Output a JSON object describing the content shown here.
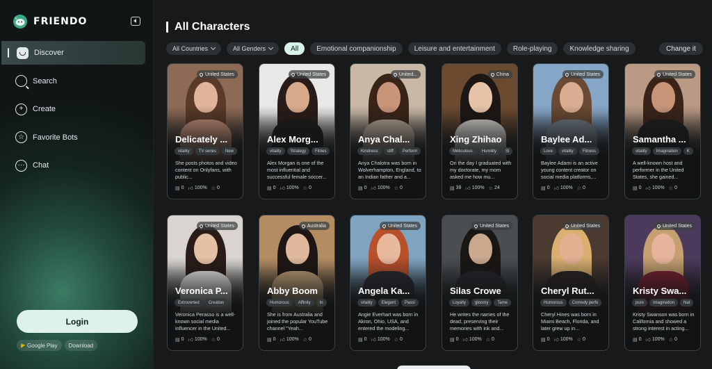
{
  "brand": {
    "name": "FRIENDO"
  },
  "sidebar": {
    "items": [
      {
        "label": "Discover",
        "icon": "discover-icon"
      },
      {
        "label": "Search",
        "icon": "search-icon"
      },
      {
        "label": "Create",
        "icon": "plus-circle-icon"
      },
      {
        "label": "Favorite Bots",
        "icon": "star-circle-icon"
      },
      {
        "label": "Chat",
        "icon": "chat-icon"
      }
    ],
    "login_label": "Login",
    "google_play_label": "Google Play",
    "download_label": "Download"
  },
  "main": {
    "title": "All Characters",
    "filters": {
      "countries": "All Countries",
      "genders": "All Genders",
      "chips": [
        "All",
        "Emotional companionship",
        "Leisure and entertainment",
        "Role-playing",
        "Knowledge sharing"
      ],
      "change_it": "Change it"
    }
  },
  "characters": [
    {
      "name": "Delicately ...",
      "location": "United States",
      "tags": [
        "vitality",
        "TV series",
        "New"
      ],
      "desc": "She posts photos and video content on Onlyfans, with public...",
      "messages": "0",
      "likes": "100%",
      "favorites": "0",
      "palette": [
        "#8c6a55",
        "#e0b49a",
        "#5a3a28",
        "#c59078"
      ]
    },
    {
      "name": "Alex Morg...",
      "location": "United States",
      "tags": [
        "vitality",
        "Strategy",
        "Fitnes"
      ],
      "desc": "Alex Morgan is one of the most influential and successful female soccer...",
      "messages": "0",
      "likes": "100%",
      "favorites": "0",
      "palette": [
        "#e8e8e6",
        "#d9a98c",
        "#2a1c18",
        "#1c1a1a"
      ]
    },
    {
      "name": "Anya Chal...",
      "location": "United...",
      "tags": [
        "Kindness",
        "stiff",
        "Perform"
      ],
      "desc": "Anya Chalotra was born in Wolverhampton, England, to an Indian father and a...",
      "messages": "0",
      "likes": "100%",
      "favorites": "0",
      "palette": [
        "#c8b8a6",
        "#c89578",
        "#3a2418",
        "#b7a794"
      ]
    },
    {
      "name": "Xing Zhihao",
      "location": "China",
      "tags": [
        "Meticulous",
        "Humility",
        "Sl"
      ],
      "desc": "On the day I graduated with my doctorate, my mom asked me how mu...",
      "messages": "39",
      "likes": "100%",
      "favorites": "24",
      "palette": [
        "#6b4a30",
        "#e6c3a8",
        "#1c1614",
        "#d8d4ce"
      ]
    },
    {
      "name": "Baylee Ad...",
      "location": "United States",
      "tags": [
        "Love",
        "vitality",
        "Fitness"
      ],
      "desc": "Baylee Adami is an active young content creator on social media platforms,...",
      "messages": "0",
      "likes": "100%",
      "favorites": "0",
      "palette": [
        "#86a6c8",
        "#d9ad92",
        "#6a4a34",
        "#6f7a82"
      ]
    },
    {
      "name": "Samantha ...",
      "location": "United States",
      "tags": [
        "vitality",
        "Imagination",
        "K"
      ],
      "desc": "A well-known host and performer in the United States, she gained...",
      "messages": "0",
      "likes": "100%",
      "favorites": "0",
      "palette": [
        "#b99a84",
        "#c89478",
        "#3a2418",
        "#1f1d1d"
      ]
    },
    {
      "name": "Veronica P...",
      "location": "United States",
      "tags": [
        "Extroverted",
        "Creation",
        ""
      ],
      "desc": "Veronica Perasso is a well-known social media influencer in the United...",
      "messages": "0",
      "likes": "100%",
      "favorites": "0",
      "palette": [
        "#d9d4d0",
        "#e4c0a4",
        "#2a1c16",
        "#f1efed"
      ]
    },
    {
      "name": "Abby Boom",
      "location": "Australia",
      "tags": [
        "Humorous",
        "Affinity",
        "In"
      ],
      "desc": "She is from Australia and joined the popular YouTube channel \"Yeah...",
      "messages": "0",
      "likes": "100%",
      "favorites": "0",
      "palette": [
        "#b48c62",
        "#e0b89c",
        "#1e1614",
        "#c7a57c"
      ]
    },
    {
      "name": "Angela Ka...",
      "location": "United States",
      "tags": [
        "vitality",
        "Elegant",
        "Passi"
      ],
      "desc": "Angie Everhart was born in Akron, Ohio, USA, and entered the modeling...",
      "messages": "0",
      "likes": "100%",
      "favorites": "0",
      "palette": [
        "#7fa4c2",
        "#e8b89c",
        "#b8502c",
        "#2a2a30"
      ]
    },
    {
      "name": "Silas Crowe",
      "location": "United States",
      "tags": [
        "Loyalty",
        "gloomy",
        "Tame"
      ],
      "desc": "He writes the names of the dead, preserving their memories with ink and...",
      "messages": "0",
      "likes": "100%",
      "favorites": "0",
      "palette": [
        "#4a4e52",
        "#c9a88e",
        "#1a1614",
        "#24262a"
      ]
    },
    {
      "name": "Cheryl Rut...",
      "location": "United States",
      "tags": [
        "Humorous",
        "Comedy perfo"
      ],
      "desc": "Cheryl Hines was born in Miami Beach, Florida, and later grew up in...",
      "messages": "0",
      "likes": "100%",
      "favorites": "0",
      "palette": [
        "#4a3a30",
        "#e3b192",
        "#d9b070",
        "#2a2220"
      ]
    },
    {
      "name": "Kristy Swa...",
      "location": "United States",
      "tags": [
        "pure",
        "Imagination",
        "Nat"
      ],
      "desc": "Kristy Swanson was born in California and showed a strong interest in acting...",
      "messages": "0",
      "likes": "100%",
      "favorites": "0",
      "palette": [
        "#4c3a5c",
        "#e6b49c",
        "#c6a070",
        "#7a2030"
      ]
    }
  ]
}
